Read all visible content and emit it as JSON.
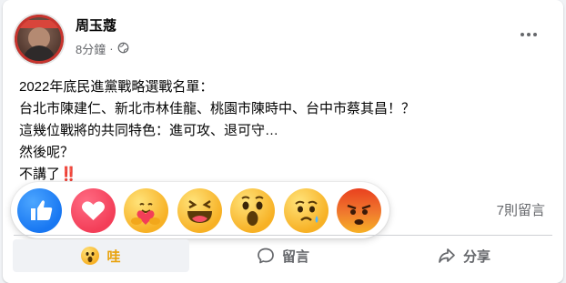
{
  "post": {
    "author": "周玉蔻",
    "time": "8分鐘",
    "separator": "·",
    "lines": [
      "2022年底民進黨戰略選戰名單：",
      "台北市陳建仁、新北市林佳龍、桃園市陳時中、台中市蔡其昌！？",
      "這幾位戰將的共同特色：進可攻、退可守…",
      "然後呢？",
      "不講了"
    ],
    "last_line_emoji": "‼️",
    "comment_count": "7則留言"
  },
  "reactions": [
    {
      "name": "like",
      "icon": "thumbs-up-icon",
      "color": "#1877f2"
    },
    {
      "name": "love",
      "icon": "heart-icon",
      "color": "#f33e58"
    },
    {
      "name": "care",
      "icon": "care-hug-icon",
      "color": "#f7b125"
    },
    {
      "name": "haha",
      "icon": "haha-face-icon",
      "color": "#f7b125"
    },
    {
      "name": "wow",
      "icon": "wow-face-icon",
      "color": "#f7b125"
    },
    {
      "name": "sad",
      "icon": "sad-face-icon",
      "color": "#f7b125"
    },
    {
      "name": "angry",
      "icon": "angry-face-icon",
      "color": "#e9401f"
    }
  ],
  "actions": {
    "react_label": "哇",
    "comment_label": "留言",
    "share_label": "分享"
  },
  "colors": {
    "accent": "#1877f2",
    "active_reaction_text": "#e8a20c",
    "secondary_text": "#65676b",
    "alert_red": "#e41e3f"
  }
}
